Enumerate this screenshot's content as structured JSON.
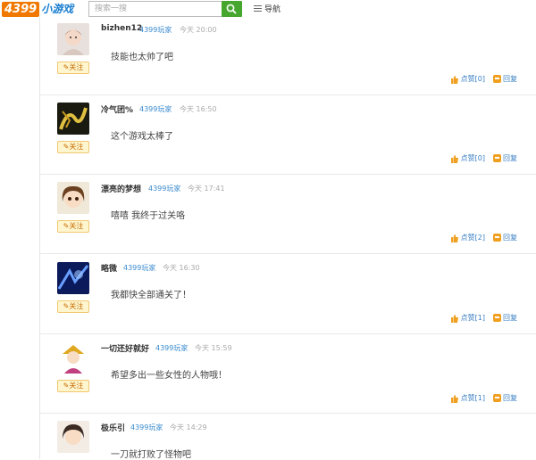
{
  "header": {
    "logo_num": "4399",
    "logo_text": "小游戏",
    "search_placeholder": "搜索一搜",
    "nav_label": "导航"
  },
  "labels": {
    "follow": "✎关注",
    "like_prefix": "点赞",
    "reply": "回复"
  },
  "comments": [
    {
      "name": "bizhen12",
      "role": "4399玩家",
      "time": "今天 20:00",
      "text": "技能也太帅了吧",
      "likes": "[0]"
    },
    {
      "name": "冷气团%",
      "role": "4399玩家",
      "time": "今天 16:50",
      "text": "这个游戏太棒了",
      "likes": "[0]"
    },
    {
      "name": "漂亮的梦想",
      "role": "4399玩家",
      "time": "今天 17:41",
      "text": "嘻嘻   我终于过关咯",
      "likes": "[2]"
    },
    {
      "name": "略微",
      "role": "4399玩家",
      "time": "今天 16:30",
      "text": "我都快全部通关了！",
      "likes": "[1]"
    },
    {
      "name": "一切还好就好",
      "role": "4399玩家",
      "time": "今天 15:59",
      "text": "希望多出一些女性的人物哦！",
      "likes": "[1]"
    },
    {
      "name": "极乐引",
      "role": "4399玩家",
      "time": "今天 14:29",
      "text": "一刀就打败了怪物吧",
      "likes": ""
    }
  ],
  "colors": {
    "brand_orange": "#f07800",
    "brand_blue": "#1a7fd0",
    "search_green": "#47a62e",
    "link_blue": "#3a7fc4"
  }
}
